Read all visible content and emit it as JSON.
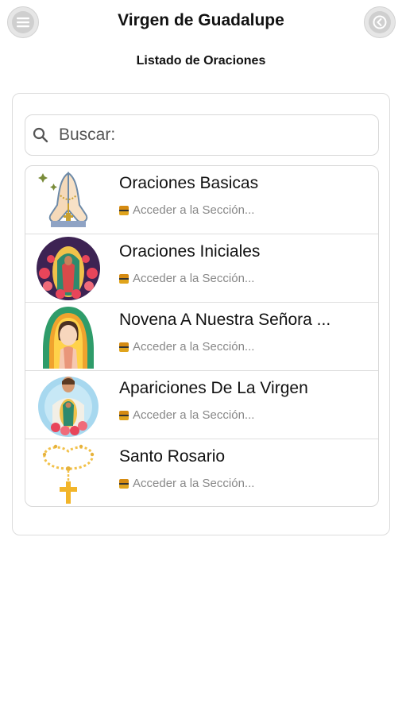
{
  "header": {
    "title": "Virgen de Guadalupe",
    "menu_icon": "menu-icon",
    "back_icon": "back-arrow-icon"
  },
  "subtitle": "Listado de Oraciones",
  "search": {
    "placeholder": "Buscar:",
    "value": ""
  },
  "items": [
    {
      "title": "Oraciones Basicas",
      "subtitle": "Acceder a la Sección...",
      "icon": "praying-hands-rosary-icon"
    },
    {
      "title": "Oraciones Iniciales",
      "subtitle": "Acceder a la Sección...",
      "icon": "virgin-guadalupe-roses-icon"
    },
    {
      "title": "Novena A Nuestra Señora ...",
      "subtitle": "Acceder a la Sección...",
      "icon": "virgin-mary-icon"
    },
    {
      "title": "Apariciones De La Virgen",
      "subtitle": "Acceder a la Sección...",
      "icon": "juan-diego-apparition-icon"
    },
    {
      "title": "Santo Rosario",
      "subtitle": "Acceder a la Sección...",
      "icon": "rosary-cross-icon"
    }
  ],
  "colors": {
    "button_bg": "#e6e6e6",
    "border": "#dcdcdc",
    "subtext": "#888888",
    "accent_icon": "#d58b12"
  }
}
